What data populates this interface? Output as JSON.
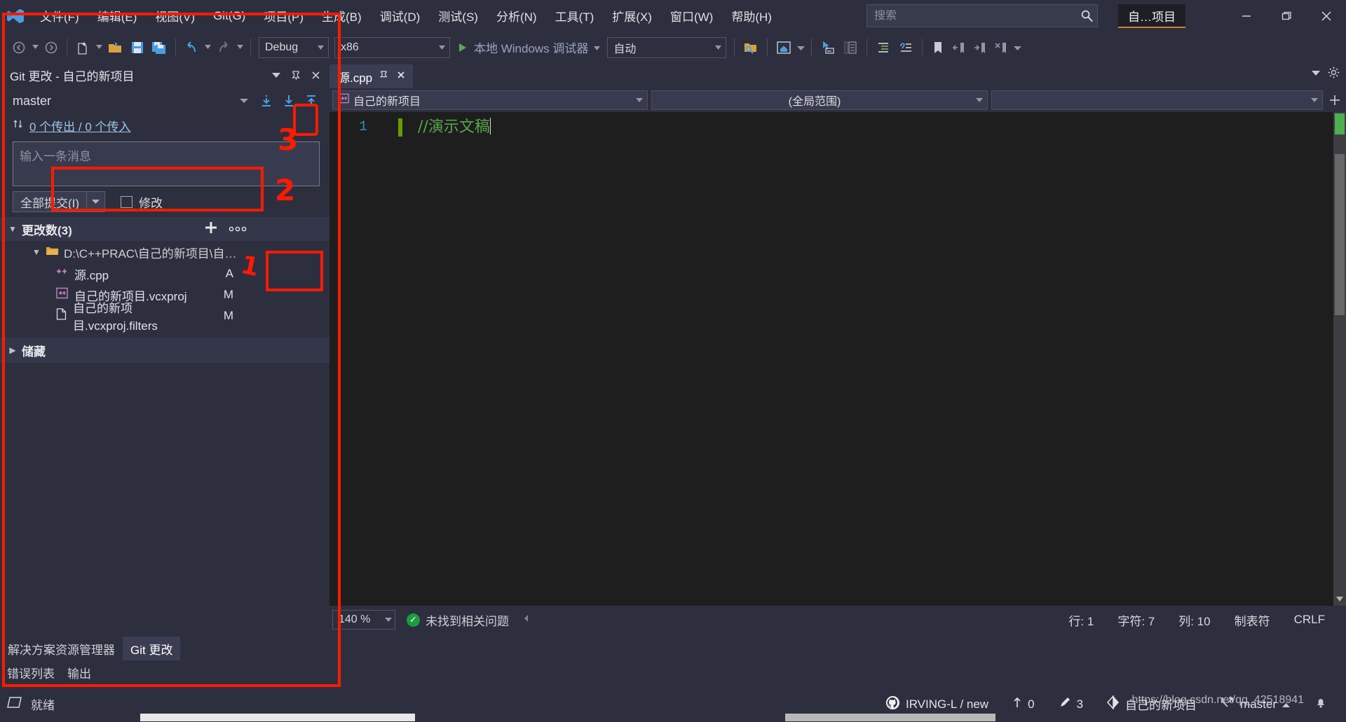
{
  "window": {
    "project_chip": "自…项目",
    "minimize": "–",
    "restore": "❐",
    "close": "✕"
  },
  "menu": {
    "items": [
      {
        "label": "文件(F)",
        "name": "menu-file"
      },
      {
        "label": "编辑(E)",
        "name": "menu-edit"
      },
      {
        "label": "视图(V)",
        "name": "menu-view"
      },
      {
        "label": "Git(G)",
        "name": "menu-git"
      },
      {
        "label": "项目(P)",
        "name": "menu-project"
      },
      {
        "label": "生成(B)",
        "name": "menu-build"
      },
      {
        "label": "调试(D)",
        "name": "menu-debug"
      },
      {
        "label": "测试(S)",
        "name": "menu-test"
      },
      {
        "label": "分析(N)",
        "name": "menu-analyze"
      },
      {
        "label": "工具(T)",
        "name": "menu-tools"
      },
      {
        "label": "扩展(X)",
        "name": "menu-extensions"
      },
      {
        "label": "窗口(W)",
        "name": "menu-window"
      },
      {
        "label": "帮助(H)",
        "name": "menu-help"
      }
    ]
  },
  "search": {
    "placeholder": "搜索",
    "value": ""
  },
  "toolbar": {
    "config": "Debug",
    "platform": "x86",
    "run_label": "本地 Windows 调试器",
    "auto_label": "自动",
    "live_share": "Live Share"
  },
  "git_panel": {
    "title": "Git 更改 - 自己的新项目",
    "branch": "master",
    "sync_text": "0 个传出 / 0 个传入",
    "message_placeholder": "输入一条消息",
    "message_value": "",
    "commit_all_label": "全部提交(I)",
    "amend_label": "修改",
    "changes_header": "更改数(3)",
    "folder": "D:\\C++PRAC\\自己的新项目\\自…",
    "files": [
      {
        "name": "源.cpp",
        "status": "A",
        "icon": "cpp-file-icon"
      },
      {
        "name": "自己的新项目.vcxproj",
        "status": "M",
        "icon": "vcxproj-file-icon"
      },
      {
        "name": "自己的新项目.vcxproj.filters",
        "status": "M",
        "icon": "generic-file-icon"
      }
    ],
    "stash_header": "储藏",
    "tabs": [
      {
        "label": "解决方案资源管理器",
        "active": false
      },
      {
        "label": "Git 更改",
        "active": true
      }
    ],
    "bottom_tabs": [
      {
        "label": "错误列表"
      },
      {
        "label": "输出"
      }
    ]
  },
  "editor": {
    "tab_label": "源.cpp",
    "scope_project": "自己的新项目",
    "scope_global": "(全局范围)",
    "scope_member": "",
    "line_number": "1",
    "code_line": "//演示文稿",
    "zoom": "140 %",
    "issue_status": "未找到相关问题",
    "status": {
      "line": "行: 1",
      "chars": "字符: 7",
      "col": "列: 10",
      "tabs": "制表符",
      "eol": "CRLF"
    }
  },
  "statusbar": {
    "ready": "就绪",
    "repo": "IRVING-L / new",
    "outgoing": "0",
    "changes": "3",
    "project": "自己的新项目",
    "branch": "master",
    "watermark": "https://blog.csdn.net/qq_42518941"
  },
  "annotations": [
    {
      "label": "1",
      "name": "annotation-number-1"
    },
    {
      "label": "2",
      "name": "annotation-number-2"
    },
    {
      "label": "3",
      "name": "annotation-number-3"
    }
  ],
  "colors": {
    "accent_blue": "#4a9ee0",
    "annotation_red": "#ff1a00",
    "comment_green": "#57a64a",
    "linenum_blue": "#2b91af",
    "chrome_bg": "#2d2f3f",
    "editor_bg": "#1e1e1e"
  }
}
